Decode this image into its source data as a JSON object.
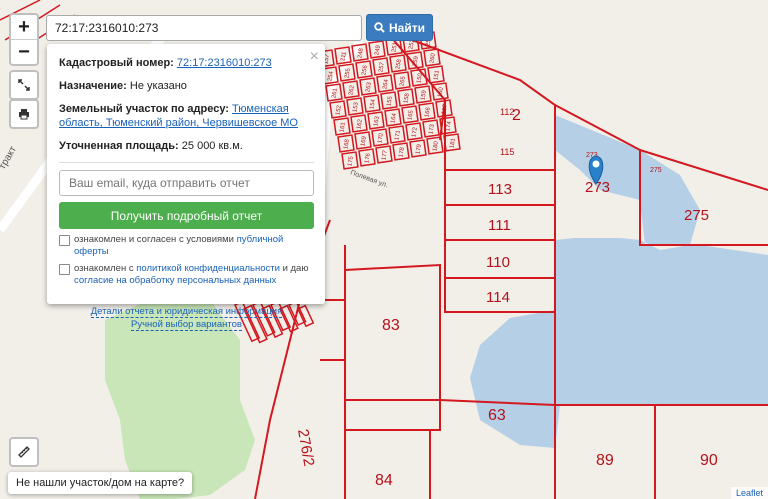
{
  "search": {
    "value": "72:17:2316010:273",
    "button_label": "Найти"
  },
  "controls": {
    "zoom_in": "+",
    "zoom_out": "−"
  },
  "popup": {
    "cadastral_label": "Кадастровый номер:",
    "cadastral_value": "72:17:2316010:273",
    "purpose_label": "Назначение:",
    "purpose_value": "Не указано",
    "address_label": "Земельный участок по адресу:",
    "address_value": "Тюменская область, Тюменский район, Червишевское МО",
    "area_label": "Уточненная площадь:",
    "area_value": "25 000 кв.м.",
    "email_placeholder": "Ваш email, куда отправить отчет",
    "report_button": "Получить подробный отчет",
    "consent1_text": "ознакомлен и согласен с условиями",
    "consent1_link": "публичной оферты",
    "consent2_text": "ознакомлен с",
    "consent2_link": "политикой конфиденциальности",
    "consent2_text2": "и даю",
    "consent2_link2": "согласие на обработку персональных данных",
    "link_details": "Детали отчета и юридическая информация",
    "link_manual": "Ручной выбор вариантов",
    "close": "×"
  },
  "not_found": "Не нашли участок/дом на карте?",
  "attribution": "Leaflet",
  "map": {
    "colors": {
      "background": "#f2efe9",
      "water": "#b5d0e6",
      "forest": "#c8e6b8",
      "parcel": "#d41820"
    },
    "street_label": "Полевая ул.",
    "road_label": "тракт",
    "parcel_labels": [
      "112",
      "2",
      "115",
      "113",
      "111",
      "110",
      "114",
      "83",
      "63",
      "84",
      "89",
      "90",
      "273",
      "275",
      "276/2"
    ],
    "marker_label": "273",
    "small_labels": [
      "157",
      "211",
      "248",
      "249",
      "251",
      "252",
      "253",
      "254",
      "255",
      "256",
      "257",
      "258",
      "259",
      "260",
      "261",
      "262",
      "263",
      "264",
      "265",
      "150",
      "151",
      "152",
      "153",
      "154",
      "155",
      "158",
      "159",
      "160",
      "161",
      "162",
      "163",
      "164",
      "165",
      "166",
      "167",
      "168",
      "169",
      "170",
      "171",
      "172",
      "173",
      "174",
      "175",
      "176",
      "177",
      "178",
      "179",
      "180",
      "181",
      "182",
      "183",
      "184",
      "185",
      "186",
      "187",
      "188",
      "189",
      "190",
      "191",
      "192",
      "193",
      "194",
      "195",
      "196",
      "197",
      "198",
      "199",
      "200"
    ]
  }
}
